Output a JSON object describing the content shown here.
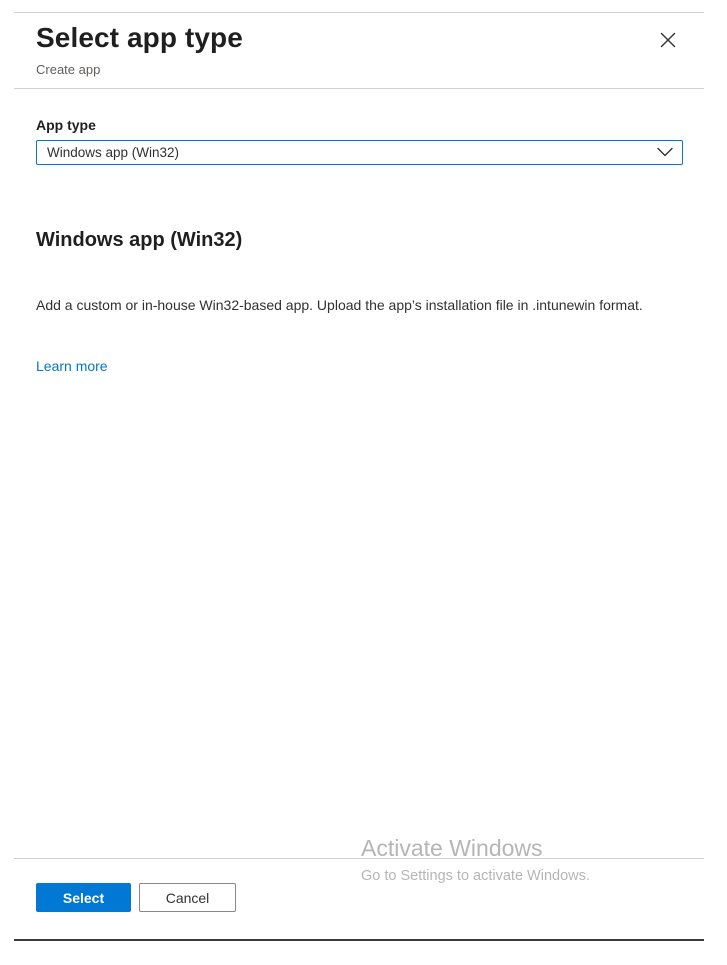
{
  "header": {
    "title": "Select app type",
    "subtitle": "Create app",
    "close_icon": "close-icon"
  },
  "form": {
    "app_type_label": "App type",
    "app_type_selected": "Windows app (Win32)",
    "dropdown_icon": "chevron-down-icon"
  },
  "details": {
    "heading": "Windows app (Win32)",
    "description": "Add a custom or in-house Win32-based app. Upload the app’s installation file in .intunewin format.",
    "learn_more_label": "Learn more"
  },
  "watermark": {
    "title": "Activate Windows",
    "subtitle": "Go to Settings to activate Windows."
  },
  "footer": {
    "select_label": "Select",
    "cancel_label": "Cancel"
  },
  "colors": {
    "accent": "#0078d4",
    "text": "#323130",
    "muted": "#605e5c",
    "watermark": "#b5b5b5"
  }
}
